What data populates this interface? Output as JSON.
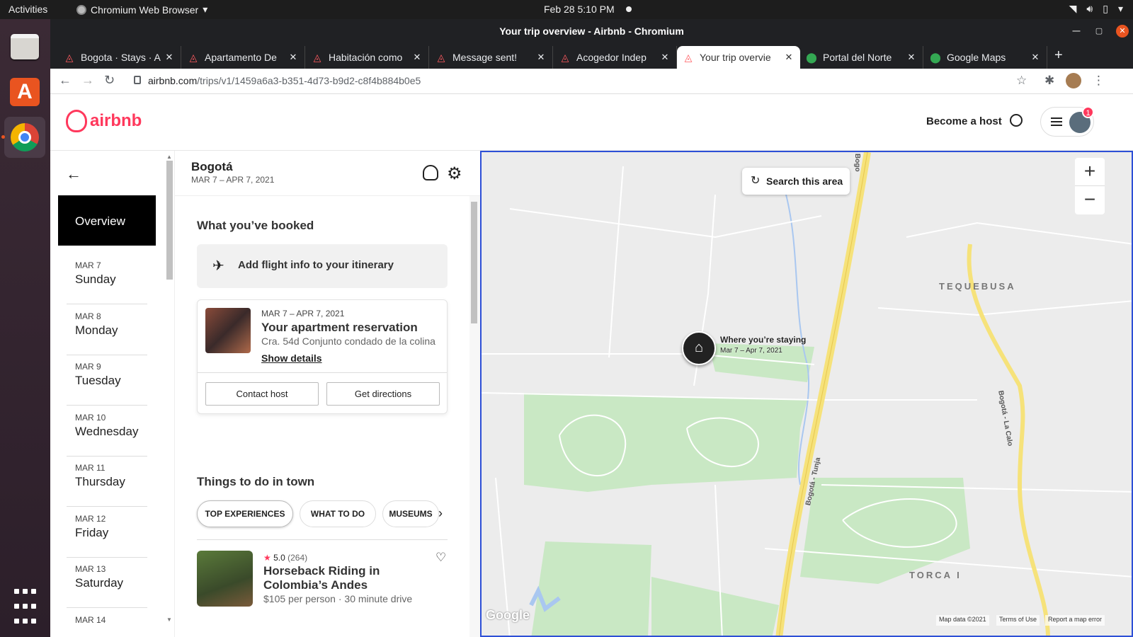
{
  "os": {
    "activities": "Activities",
    "app_name": "Chromium Web Browser",
    "clock": "Feb 28  5:10 PM"
  },
  "window": {
    "title": "Your trip overview - Airbnb - Chromium"
  },
  "tabs": [
    {
      "label": "Bogota · Stays · A",
      "favicon": "airbnb-icon"
    },
    {
      "label": "Apartamento De",
      "favicon": "airbnb-icon"
    },
    {
      "label": "Habitación como",
      "favicon": "airbnb-icon"
    },
    {
      "label": "Message sent!",
      "favicon": "airbnb-icon"
    },
    {
      "label": "Acogedor Indep",
      "favicon": "airbnb-icon"
    },
    {
      "label": "Your trip overvie",
      "favicon": "airbnb-icon",
      "active": true
    },
    {
      "label": "Portal del Norte",
      "favicon": "maps-icon"
    },
    {
      "label": "Google Maps",
      "favicon": "maps-icon"
    }
  ],
  "address_bar": {
    "domain": "airbnb.com",
    "path": "/trips/v1/1459a6a3-b351-4d73-b9d2-c8f4b884b0e5"
  },
  "header": {
    "logo_text": "airbnb",
    "become_host": "Become a host",
    "notification_count": "1",
    "brand_color": "#ff385c"
  },
  "daynav": {
    "overview": "Overview",
    "days": [
      {
        "date": "MAR 7",
        "name": "Sunday"
      },
      {
        "date": "MAR 8",
        "name": "Monday"
      },
      {
        "date": "MAR 9",
        "name": "Tuesday"
      },
      {
        "date": "MAR 10",
        "name": "Wednesday"
      },
      {
        "date": "MAR 11",
        "name": "Thursday"
      },
      {
        "date": "MAR 12",
        "name": "Friday"
      },
      {
        "date": "MAR 13",
        "name": "Saturday"
      },
      {
        "date": "MAR 14",
        "name": ""
      }
    ]
  },
  "trip": {
    "city": "Bogotá",
    "dates": "MAR 7 – APR 7, 2021"
  },
  "booked": {
    "heading": "What you’ve booked",
    "flight_prompt": "Add flight info to your itinerary",
    "reservation": {
      "dates": "MAR 7 – APR 7, 2021",
      "title": "Your apartment reservation",
      "address": "Cra. 54d Conjunto condado de la colina",
      "details_link": "Show details",
      "contact_button": "Contact host",
      "directions_button": "Get directions"
    }
  },
  "things": {
    "heading": "Things to do in town",
    "pills": [
      "TOP EXPERIENCES",
      "WHAT TO DO",
      "MUSEUMS"
    ],
    "experience": {
      "rating": "5.0",
      "reviews": "(264)",
      "title": "Horseback Riding in Colombia’s Andes",
      "price": "$105 per person · 30 minute drive"
    }
  },
  "map": {
    "search_area": "Search this area",
    "pin_title": "Where you’re staying",
    "pin_dates": "Mar 7 – Apr 7, 2021",
    "places": [
      "TEQUEBUSA",
      "TORCA I"
    ],
    "roads": [
      "Bogotá - Tunja",
      "Bogotá - La Calo",
      "Bogo"
    ],
    "google": "Google",
    "map_data": "Map data ©2021",
    "terms": "Terms of Use",
    "report": "Report a map error",
    "colors": {
      "park": "#c9e8c4",
      "highway": "#f6e27a",
      "water": "#a9c7f0",
      "land": "#ececec"
    }
  }
}
